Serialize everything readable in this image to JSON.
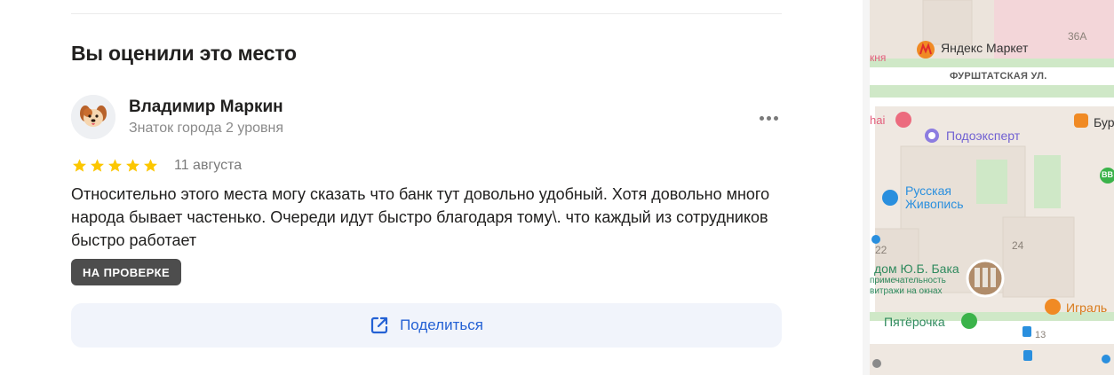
{
  "review_section": {
    "title": "Вы оценили это место",
    "user": {
      "name": "Владимир Маркин",
      "level": "Знаток города 2 уровня",
      "avatar_icon": "puppy-avatar-icon"
    },
    "rating": 5,
    "rating_max": 5,
    "date": "11 августа",
    "text": "Относительно этого места могу сказать что банк тут довольно удобный. Хотя довольно много народа бывает частенько. Очереди идут быстро благодаря тому\\. что каждый из сотрудников быстро работает",
    "status_badge": "НА ПРОВЕРКЕ",
    "share_label": "Поделиться",
    "more_icon": "more-dots-icon"
  },
  "map": {
    "labels": {
      "yandex_market": "Яндекс Маркет",
      "building_36a": "36А",
      "street": "ФУРШТАТСКАЯ УЛ.",
      "left_fragment": "кня",
      "podoexpert": "Подоэксперт",
      "hai_fragment": "hai",
      "bur_fragment": "Бур",
      "russkaya_1": "Русская",
      "russkaya_2": "Живопись",
      "num_22": "22",
      "num_24": "24",
      "num_13": "13",
      "house_title": "дом Ю.Б. Бака",
      "house_sub1": "примечательность",
      "house_sub2": "витражи на окнах",
      "pyaterochka": "Пятёрочка",
      "igral": "Играль",
      "bb": "ВВ"
    },
    "colors": {
      "road": "#ffffff",
      "green": "#cfe8c7",
      "poi_blue": "#2a8fde",
      "poi_orange": "#f08a24",
      "poi_red": "#ec4b4b"
    }
  }
}
